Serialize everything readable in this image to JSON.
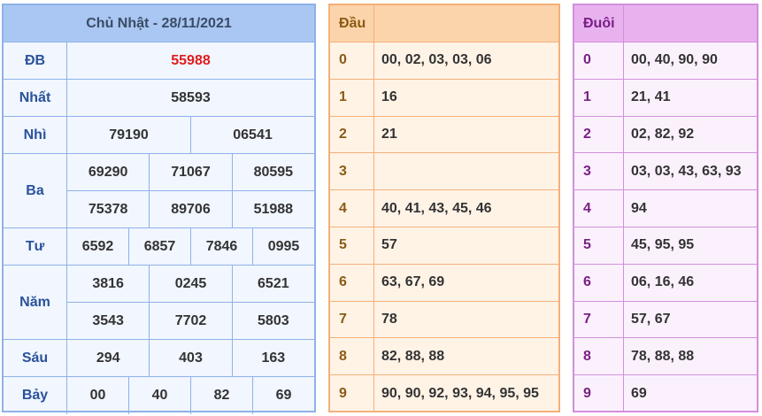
{
  "results": {
    "title": "Chủ Nhật - 28/11/2021",
    "prizes": [
      {
        "label": "ĐB",
        "lines": [
          [
            "55988"
          ]
        ]
      },
      {
        "label": "Nhất",
        "lines": [
          [
            "58593"
          ]
        ]
      },
      {
        "label": "Nhì",
        "lines": [
          [
            "79190",
            "06541"
          ]
        ]
      },
      {
        "label": "Ba",
        "lines": [
          [
            "69290",
            "71067",
            "80595"
          ],
          [
            "75378",
            "89706",
            "51988"
          ]
        ]
      },
      {
        "label": "Tư",
        "lines": [
          [
            "6592",
            "6857",
            "7846",
            "0995"
          ]
        ]
      },
      {
        "label": "Năm",
        "lines": [
          [
            "3816",
            "0245",
            "6521"
          ],
          [
            "3543",
            "7702",
            "5803"
          ]
        ]
      },
      {
        "label": "Sáu",
        "lines": [
          [
            "294",
            "403",
            "163"
          ]
        ]
      },
      {
        "label": "Bảy",
        "lines": [
          [
            "00",
            "40",
            "82",
            "69"
          ]
        ]
      }
    ]
  },
  "dau": {
    "header": "Đầu",
    "rows": [
      {
        "k": "0",
        "v": "00, 02, 03, 03, 06"
      },
      {
        "k": "1",
        "v": "16"
      },
      {
        "k": "2",
        "v": "21"
      },
      {
        "k": "3",
        "v": ""
      },
      {
        "k": "4",
        "v": "40, 41, 43, 45, 46"
      },
      {
        "k": "5",
        "v": "57"
      },
      {
        "k": "6",
        "v": "63, 67, 69"
      },
      {
        "k": "7",
        "v": "78"
      },
      {
        "k": "8",
        "v": "82, 88, 88"
      },
      {
        "k": "9",
        "v": "90, 90, 92, 93, 94, 95, 95"
      }
    ]
  },
  "duoi": {
    "header": "Đuôi",
    "rows": [
      {
        "k": "0",
        "v": "00, 40, 90, 90"
      },
      {
        "k": "1",
        "v": "21, 41"
      },
      {
        "k": "2",
        "v": "02, 82, 92"
      },
      {
        "k": "3",
        "v": "03, 03, 43, 63, 93"
      },
      {
        "k": "4",
        "v": "94"
      },
      {
        "k": "5",
        "v": "45, 95, 95"
      },
      {
        "k": "6",
        "v": "06, 16, 46"
      },
      {
        "k": "7",
        "v": "57, 67"
      },
      {
        "k": "8",
        "v": "78, 88, 88"
      },
      {
        "k": "9",
        "v": "69"
      }
    ]
  }
}
